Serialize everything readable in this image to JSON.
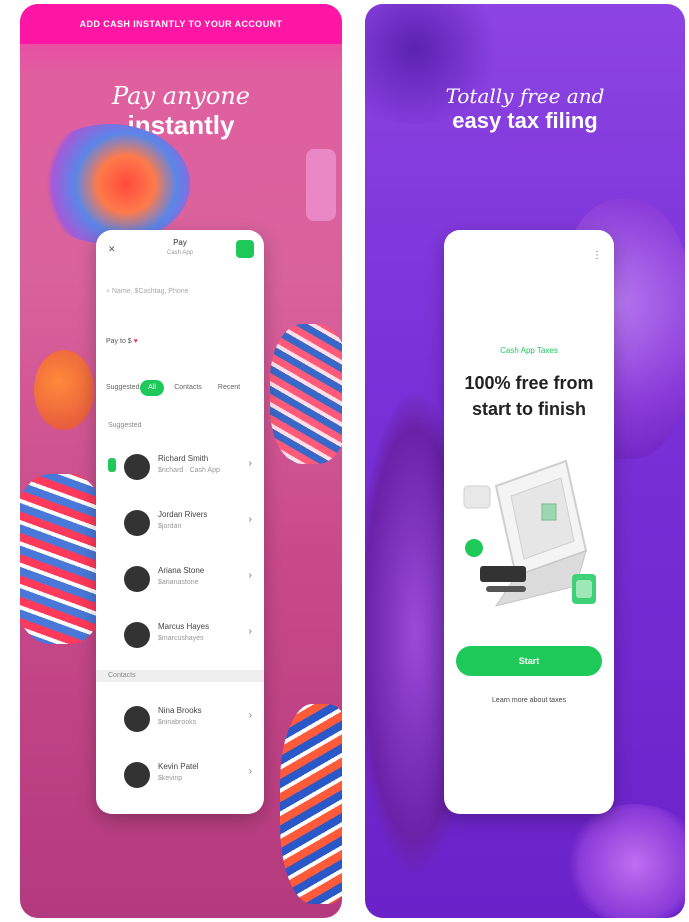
{
  "left_screen": {
    "banner": "ADD CASH INSTANTLY TO YOUR ACCOUNT",
    "headline_line1": "Pay anyone",
    "headline_line2": "instantly",
    "app": {
      "header_title": "Pay",
      "header_subtitle": "Cash App",
      "search_placeholder": "Name, $Cashtag, Phone",
      "send_to": "Pay to $",
      "tabs": [
        "Suggested",
        "All",
        "Contacts",
        "Recent"
      ],
      "section_suggested": "Suggested",
      "section_contacts": "Contacts",
      "contacts": [
        {
          "name": "Richard Smith",
          "sub": "$richard · Cash App"
        },
        {
          "name": "Jordan Rivers",
          "sub": "$jordan"
        },
        {
          "name": "Ariana Stone",
          "sub": "$arianastone"
        },
        {
          "name": "Marcus Hayes",
          "sub": "$marcushayes"
        },
        {
          "name": "Nina Brooks",
          "sub": "$ninabrooks"
        },
        {
          "name": "Kevin Patel",
          "sub": "$kevinp"
        }
      ]
    }
  },
  "right_screen": {
    "headline_line1": "Totally free and",
    "headline_line2": "easy tax filing",
    "app": {
      "kicker": "Cash App Taxes",
      "title": "100% free from start to finish",
      "primary_button": "Start",
      "secondary_button": "Learn more about taxes"
    }
  },
  "colors": {
    "left_bg": "#d8629c",
    "banner": "#ff16a4",
    "right_bg": "#7a31d8",
    "accent_green": "#1ec95a"
  }
}
